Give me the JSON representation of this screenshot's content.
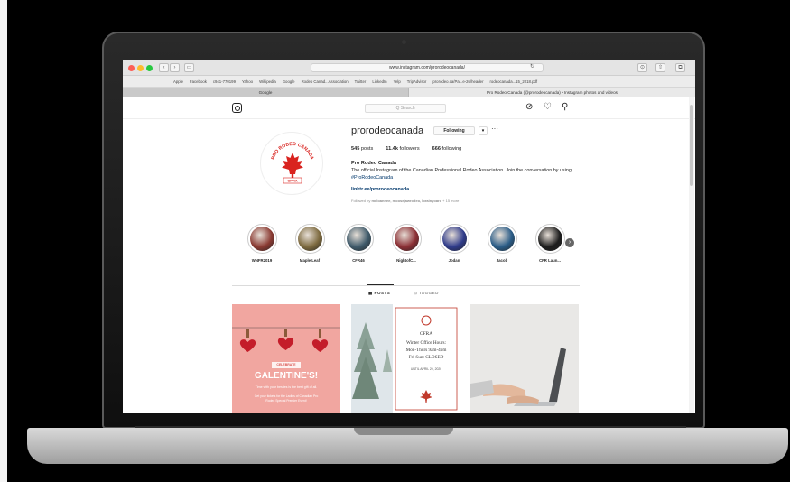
{
  "browser": {
    "url": "www.instagram.com/prorodeocanada/",
    "bookmarks": [
      "Apple",
      "Facebook",
      "c941-770199",
      "Yahoo",
      "Wikipedia",
      "Google",
      "Rodeo Canad...Association",
      "Twitter",
      "LinkedIn",
      "Yelp",
      "TripAdvisor",
      "prorodeo.ca/Pa...e-26/header",
      "rodeocanada...15_2018.pdf"
    ],
    "tabs": [
      {
        "label": "Google"
      },
      {
        "label": "Pro Rodeo Canada (@prorodeocanada) • Instagram photos and videos"
      }
    ],
    "nav_back": "‹",
    "nav_fwd": "›",
    "sidebar_btn": "▭",
    "reload": "↻",
    "download": "⊙",
    "share": "⇧",
    "tabs_btn": "⧉"
  },
  "instagram": {
    "search_placeholder": "Q Search",
    "header_icons": {
      "explore": "⊘",
      "activity": "♡",
      "profile": "⚲"
    },
    "profile": {
      "username": "prorodeocanada",
      "follow_label": "Following",
      "dropdown_label": "▾",
      "more_label": "···",
      "avatar_text_top": "PRO RODEO CANADA",
      "avatar_text_bottom": "CPRA",
      "posts": "545",
      "posts_label": "posts",
      "followers": "11.4k",
      "followers_label": "followers",
      "following": "666",
      "following_label": "following",
      "name": "Pro Rodeo Canada",
      "bio": "The official Instagram of the Canadian Professional Rodeo Association. Join the conversation by using",
      "bio_hashtag": "#ProRodeoCanada",
      "link": "linktr.ee/prorodeocanada",
      "followed_by_prefix": "Followed by",
      "followed_by": "meloannee, moosejawrodeo, lorainyoard",
      "followed_more": "+ 15 more"
    },
    "highlights": [
      {
        "label": "WNFR2019",
        "color": "#8a3a32"
      },
      {
        "label": "Maple Leaf",
        "color": "#7d6a3f"
      },
      {
        "label": "CFR46",
        "color": "#3f5a6a"
      },
      {
        "label": "NightofC...",
        "color": "#8b2f34"
      },
      {
        "label": "Jodan",
        "color": "#2f3b8a"
      },
      {
        "label": "Jacob",
        "color": "#2a5c87"
      },
      {
        "label": "CFR Laun...",
        "color": "#1d1d1d"
      }
    ],
    "tabs": {
      "posts": "▦ POSTS",
      "tagged": "⊡ TAGGED"
    },
    "posts": {
      "galentine": {
        "badge": "CELEBRATE",
        "title": "GALENTINE'S!",
        "line1": "Time with your besties is the best gift of all.",
        "line2": "Get your tickets for the Ladies of Canadian Pro Rodeo Special Premier Event!"
      },
      "notice": {
        "org": "CFRA",
        "line1": "Winter Office Hours:",
        "line2": "Mon-Thurs 9am-4pm",
        "line3": "Fri-Sun: CLOSED",
        "line4": "UNTIL APRIL 20, 2020"
      }
    }
  }
}
